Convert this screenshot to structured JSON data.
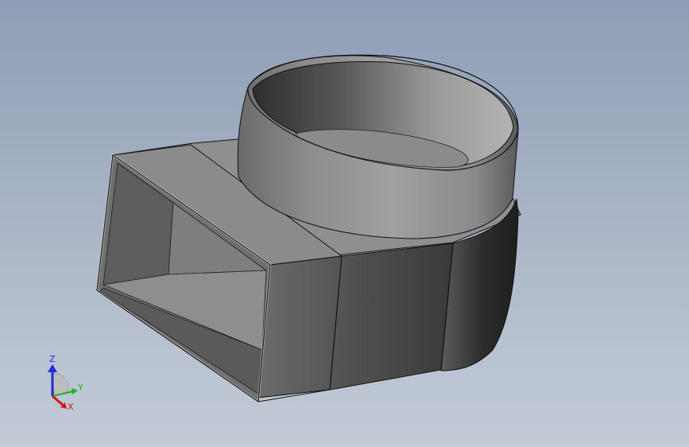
{
  "triad": {
    "z_label": "Z",
    "y_label": "Y",
    "x_label": "X",
    "z_color": "#1e2ed8",
    "y_color": "#17b81d",
    "x_color": "#d21919"
  },
  "icons": {
    "model": "rectangular-to-round-elbow-duct",
    "triad": "coordinate-triad-icon"
  }
}
